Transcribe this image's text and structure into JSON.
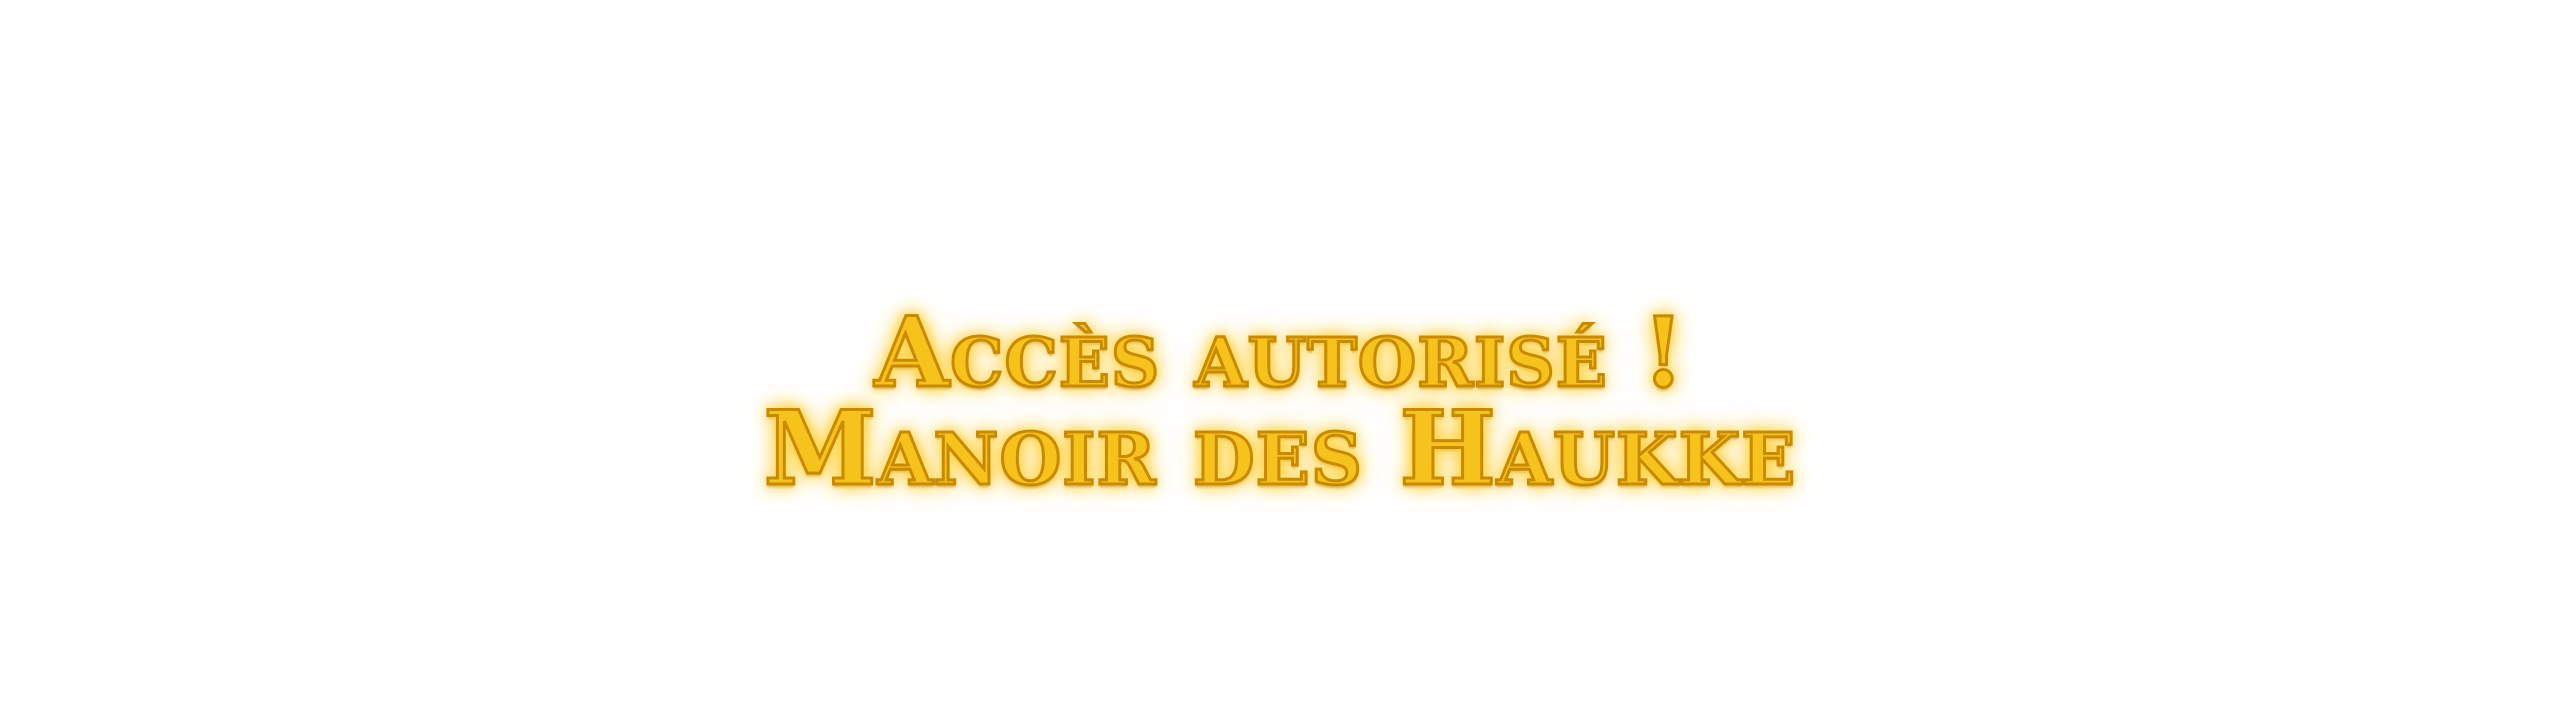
{
  "notification": {
    "line1": "Accès autorisé !",
    "line2": "Manoir des Haukke"
  },
  "colors": {
    "text_fill": "#f6c21c",
    "text_outline": "#c98a00",
    "glow": "#ffd24a",
    "background": "#ffffff"
  }
}
